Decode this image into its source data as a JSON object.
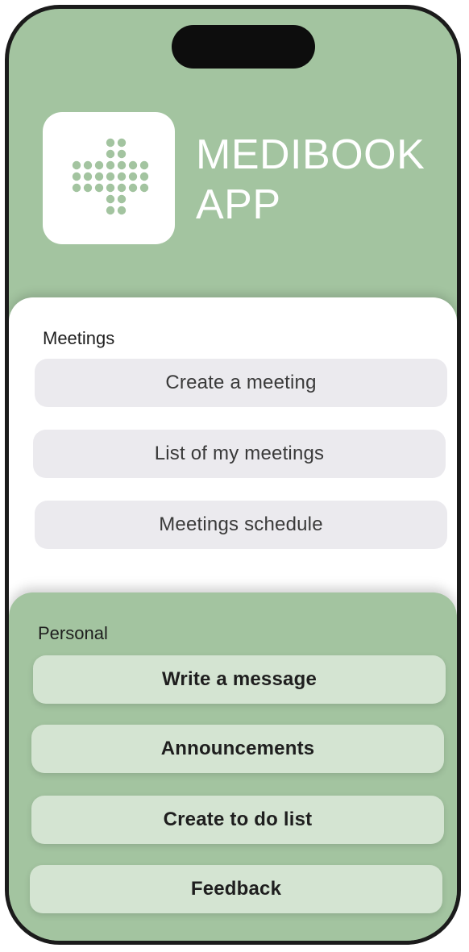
{
  "app": {
    "title_line1": "MEDIBOOK",
    "title_line2": "APP",
    "logo_icon": "dotted-medical-cross-icon"
  },
  "meetings": {
    "heading": "Meetings",
    "buttons": [
      "Create a meeting",
      "List of my meetings",
      "Meetings schedule"
    ]
  },
  "personal": {
    "heading": "Personal",
    "buttons": [
      "Write a message",
      "Announcements",
      "Create to do list",
      "Feedback"
    ]
  },
  "colors": {
    "primary_green": "#a3c4a0",
    "light_green_button": "#d4e4d2",
    "grey_button": "#ebeaee",
    "logo_dots": "#a3c4a0"
  }
}
